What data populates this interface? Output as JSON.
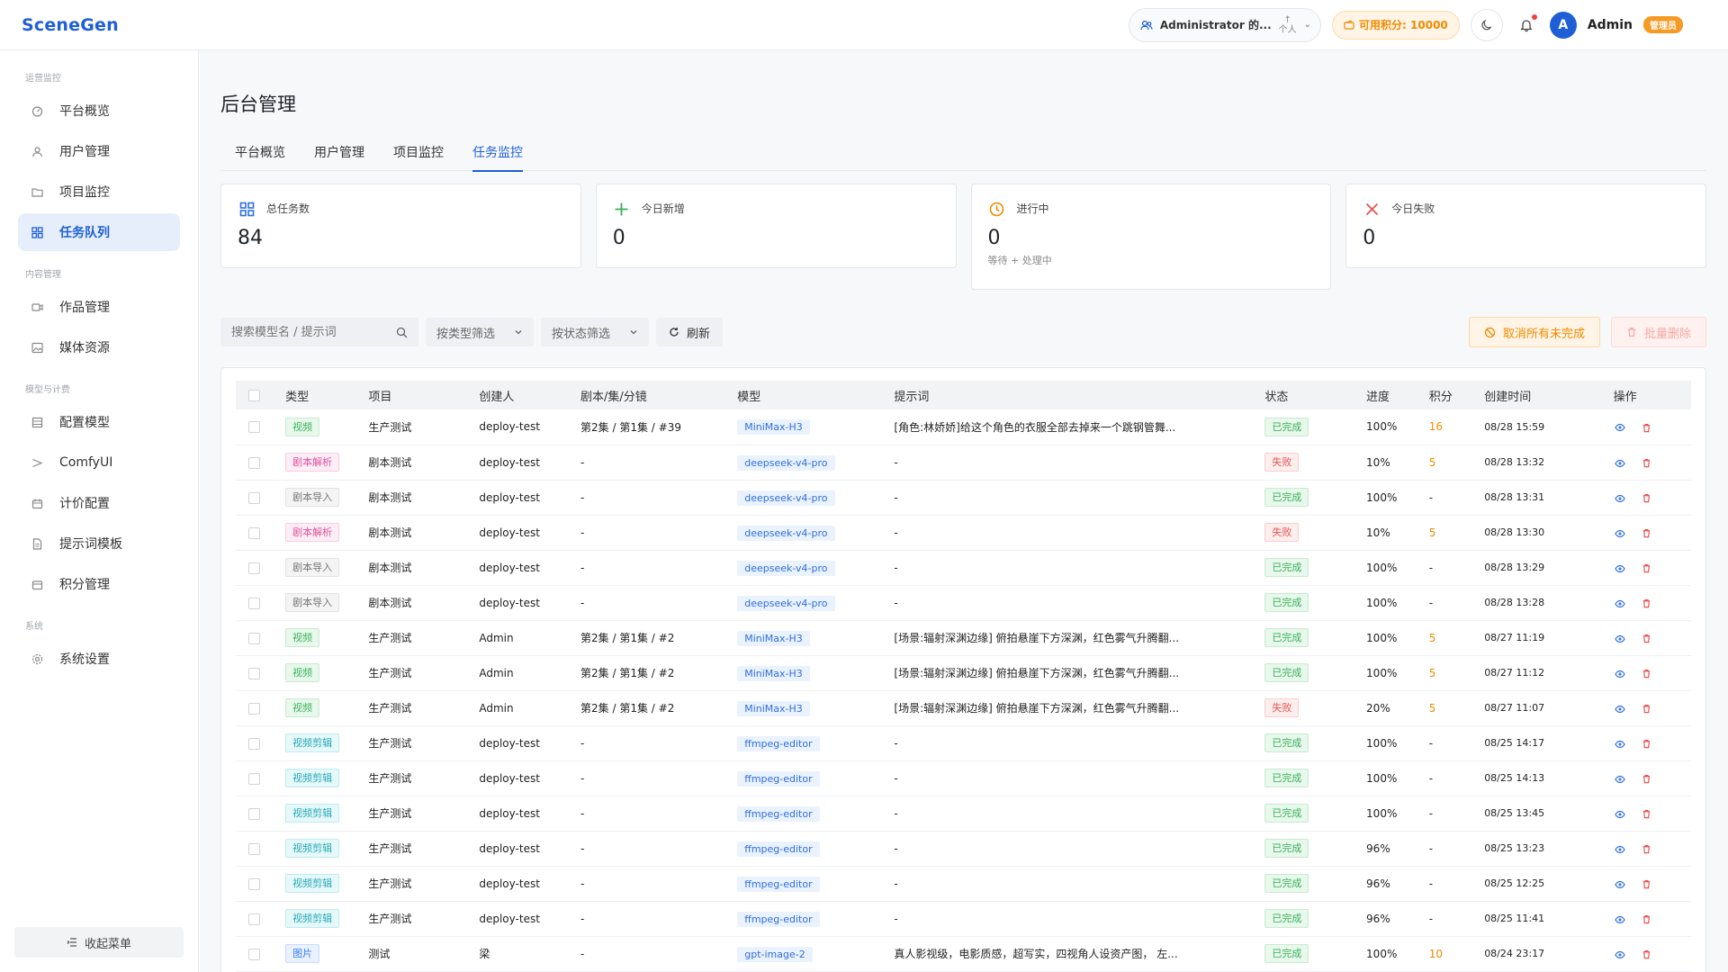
{
  "app": {
    "logo": "SceneGen"
  },
  "topbar": {
    "org_label": "Administrator 的...",
    "org_sub": "个人",
    "points_label": "可用积分: 10000",
    "avatar_letter": "A",
    "user_name": "Admin",
    "role_badge": "管理员"
  },
  "sidebar": {
    "groups": [
      {
        "title": "运营监控",
        "items": [
          {
            "label": "平台概览",
            "icon": "dashboard-icon"
          },
          {
            "label": "用户管理",
            "icon": "user-icon"
          },
          {
            "label": "项目监控",
            "icon": "folder-icon"
          },
          {
            "label": "任务队列",
            "icon": "grid-icon",
            "active": true
          }
        ]
      },
      {
        "title": "内容管理",
        "items": [
          {
            "label": "作品管理",
            "icon": "video-icon"
          },
          {
            "label": "媒体资源",
            "icon": "image-icon"
          }
        ]
      },
      {
        "title": "模型与计费",
        "items": [
          {
            "label": "配置模型",
            "icon": "list-icon"
          },
          {
            "label": "ComfyUI",
            "icon": "flow-icon"
          },
          {
            "label": "计价配置",
            "icon": "calendar-icon"
          },
          {
            "label": "提示词模板",
            "icon": "doc-icon"
          },
          {
            "label": "积分管理",
            "icon": "wallet-icon"
          }
        ]
      },
      {
        "title": "系统",
        "items": [
          {
            "label": "系统设置",
            "icon": "gear-icon"
          }
        ]
      }
    ],
    "collapse_label": "收起菜单"
  },
  "page": {
    "title": "后台管理",
    "tabs": [
      {
        "label": "平台概览"
      },
      {
        "label": "用户管理"
      },
      {
        "label": "项目监控"
      },
      {
        "label": "任务监控",
        "active": true
      }
    ]
  },
  "stats": [
    {
      "label": "总任务数",
      "value": "84",
      "icon": "grid-icon",
      "color": "#2f6fe0"
    },
    {
      "label": "今日新增",
      "value": "0",
      "icon": "plus-icon",
      "color": "#38b058"
    },
    {
      "label": "进行中",
      "value": "0",
      "sub": "等待 + 处理中",
      "icon": "clock-icon",
      "color": "#f08a00"
    },
    {
      "label": "今日失败",
      "value": "0",
      "icon": "close-icon",
      "color": "#e8534e"
    }
  ],
  "filters": {
    "search_placeholder": "搜索模型名 / 提示词",
    "type_filter": "按类型筛选",
    "status_filter": "按状态筛选",
    "refresh_label": "刷新",
    "cancel_all_label": "取消所有未完成",
    "batch_delete_label": "批量删除"
  },
  "table": {
    "columns": [
      "",
      "类型",
      "项目",
      "创建人",
      "剧本/集/分镜",
      "模型",
      "提示词",
      "状态",
      "进度",
      "积分",
      "创建时间",
      "操作"
    ],
    "rows": [
      {
        "type": "视频",
        "type_cls": "t-video",
        "project": "生产测试",
        "creator": "deploy-test",
        "scene": "第2集 / 第1集 / #39",
        "model": "MiniMax-H3",
        "prompt": "[角色:林娇娇]给这个角色的衣服全部去掉来一个跳钢管舞...",
        "status": "已完成",
        "status_cls": "t-done",
        "progress": "100%",
        "points": "16",
        "time": "08/28 15:59"
      },
      {
        "type": "剧本解析",
        "type_cls": "t-parse",
        "project": "剧本测试",
        "creator": "deploy-test",
        "scene": "-",
        "model": "deepseek-v4-pro",
        "prompt": "-",
        "status": "失败",
        "status_cls": "t-fail",
        "progress": "10%",
        "points": "5",
        "time": "08/28 13:32"
      },
      {
        "type": "剧本导入",
        "type_cls": "t-import",
        "project": "剧本测试",
        "creator": "deploy-test",
        "scene": "-",
        "model": "deepseek-v4-pro",
        "prompt": "-",
        "status": "已完成",
        "status_cls": "t-done",
        "progress": "100%",
        "points": "-",
        "time": "08/28 13:31"
      },
      {
        "type": "剧本解析",
        "type_cls": "t-parse",
        "project": "剧本测试",
        "creator": "deploy-test",
        "scene": "-",
        "model": "deepseek-v4-pro",
        "prompt": "-",
        "status": "失败",
        "status_cls": "t-fail",
        "progress": "10%",
        "points": "5",
        "time": "08/28 13:30"
      },
      {
        "type": "剧本导入",
        "type_cls": "t-import",
        "project": "剧本测试",
        "creator": "deploy-test",
        "scene": "-",
        "model": "deepseek-v4-pro",
        "prompt": "-",
        "status": "已完成",
        "status_cls": "t-done",
        "progress": "100%",
        "points": "-",
        "time": "08/28 13:29"
      },
      {
        "type": "剧本导入",
        "type_cls": "t-import",
        "project": "剧本测试",
        "creator": "deploy-test",
        "scene": "-",
        "model": "deepseek-v4-pro",
        "prompt": "-",
        "status": "已完成",
        "status_cls": "t-done",
        "progress": "100%",
        "points": "-",
        "time": "08/28 13:28"
      },
      {
        "type": "视频",
        "type_cls": "t-video",
        "project": "生产测试",
        "creator": "Admin",
        "scene": "第2集 / 第1集 / #2",
        "model": "MiniMax-H3",
        "prompt": "[场景:辐射深渊边缘] 俯拍悬崖下方深渊，红色雾气升腾翻...",
        "status": "已完成",
        "status_cls": "t-done",
        "progress": "100%",
        "points": "5",
        "time": "08/27 11:19"
      },
      {
        "type": "视频",
        "type_cls": "t-video",
        "project": "生产测试",
        "creator": "Admin",
        "scene": "第2集 / 第1集 / #2",
        "model": "MiniMax-H3",
        "prompt": "[场景:辐射深渊边缘] 俯拍悬崖下方深渊，红色雾气升腾翻...",
        "status": "已完成",
        "status_cls": "t-done",
        "progress": "100%",
        "points": "5",
        "time": "08/27 11:12"
      },
      {
        "type": "视频",
        "type_cls": "t-video",
        "project": "生产测试",
        "creator": "Admin",
        "scene": "第2集 / 第1集 / #2",
        "model": "MiniMax-H3",
        "prompt": "[场景:辐射深渊边缘] 俯拍悬崖下方深渊，红色雾气升腾翻...",
        "status": "失败",
        "status_cls": "t-fail",
        "progress": "20%",
        "points": "5",
        "time": "08/27 11:07"
      },
      {
        "type": "视频剪辑",
        "type_cls": "t-edit",
        "project": "生产测试",
        "creator": "deploy-test",
        "scene": "-",
        "model": "ffmpeg-editor",
        "prompt": "-",
        "status": "已完成",
        "status_cls": "t-done",
        "progress": "100%",
        "points": "-",
        "time": "08/25 14:17"
      },
      {
        "type": "视频剪辑",
        "type_cls": "t-edit",
        "project": "生产测试",
        "creator": "deploy-test",
        "scene": "-",
        "model": "ffmpeg-editor",
        "prompt": "-",
        "status": "已完成",
        "status_cls": "t-done",
        "progress": "100%",
        "points": "-",
        "time": "08/25 14:13"
      },
      {
        "type": "视频剪辑",
        "type_cls": "t-edit",
        "project": "生产测试",
        "creator": "deploy-test",
        "scene": "-",
        "model": "ffmpeg-editor",
        "prompt": "-",
        "status": "已完成",
        "status_cls": "t-done",
        "progress": "100%",
        "points": "-",
        "time": "08/25 13:45"
      },
      {
        "type": "视频剪辑",
        "type_cls": "t-edit",
        "project": "生产测试",
        "creator": "deploy-test",
        "scene": "-",
        "model": "ffmpeg-editor",
        "prompt": "-",
        "status": "已完成",
        "status_cls": "t-done",
        "progress": "96%",
        "points": "-",
        "time": "08/25 13:23"
      },
      {
        "type": "视频剪辑",
        "type_cls": "t-edit",
        "project": "生产测试",
        "creator": "deploy-test",
        "scene": "-",
        "model": "ffmpeg-editor",
        "prompt": "-",
        "status": "已完成",
        "status_cls": "t-done",
        "progress": "96%",
        "points": "-",
        "time": "08/25 12:25"
      },
      {
        "type": "视频剪辑",
        "type_cls": "t-edit",
        "project": "生产测试",
        "creator": "deploy-test",
        "scene": "-",
        "model": "ffmpeg-editor",
        "prompt": "-",
        "status": "已完成",
        "status_cls": "t-done",
        "progress": "96%",
        "points": "-",
        "time": "08/25 11:41"
      },
      {
        "type": "图片",
        "type_cls": "t-image",
        "project": "测试",
        "creator": "梁",
        "scene": "-",
        "model": "gpt-image-2",
        "prompt": "真人影视级，电影质感，超写实，四视角人设资产图， 左...",
        "status": "已完成",
        "status_cls": "t-done",
        "progress": "100%",
        "points": "10",
        "time": "08/24 23:17"
      }
    ]
  },
  "colors": {
    "accent": "#1f5fd6",
    "success": "#38b058",
    "warning": "#f08a00",
    "danger": "#e8534e"
  }
}
